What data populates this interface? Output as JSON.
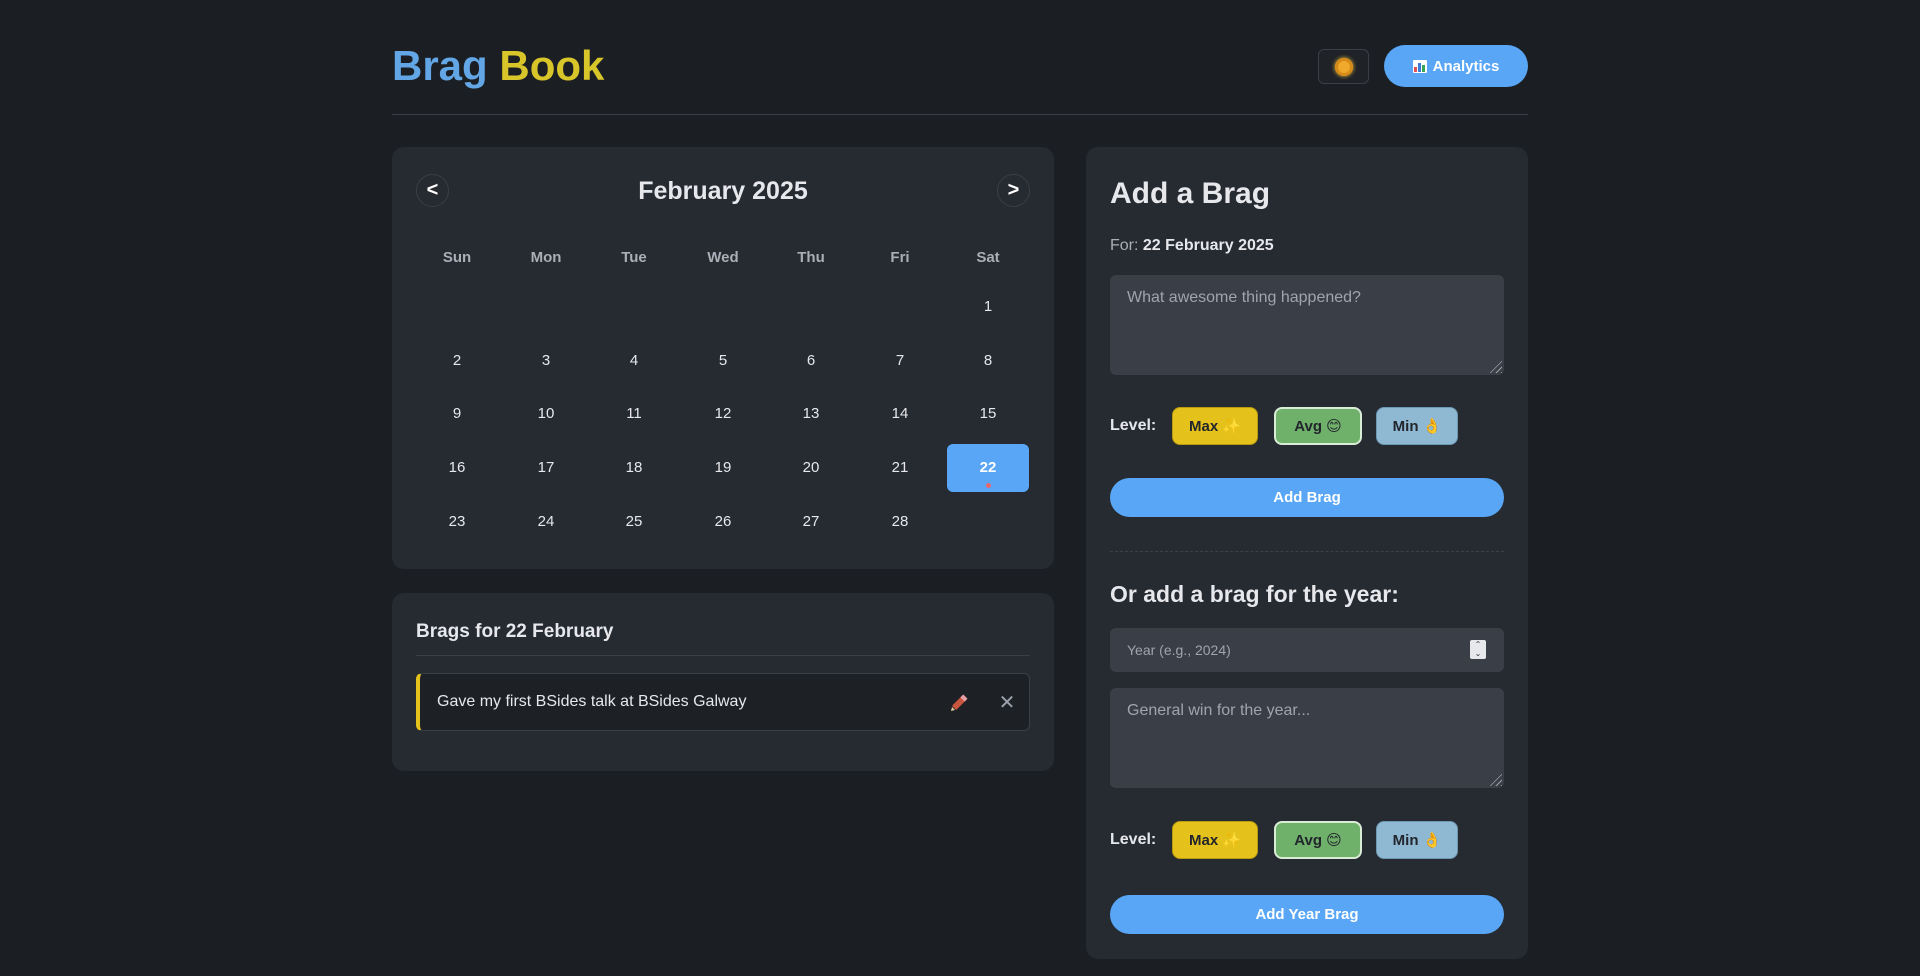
{
  "header": {
    "brand_word1": "Brag",
    "brand_word2": "Book",
    "analytics_label": "Analytics"
  },
  "calendar": {
    "month_label": "February 2025",
    "prev_label": "<",
    "next_label": ">",
    "weekdays": [
      "Sun",
      "Mon",
      "Tue",
      "Wed",
      "Thu",
      "Fri",
      "Sat"
    ],
    "days": {
      "d1": "1",
      "d2": "2",
      "d3": "3",
      "d4": "4",
      "d5": "5",
      "d6": "6",
      "d7": "7",
      "d8": "8",
      "d9": "9",
      "d10": "10",
      "d11": "11",
      "d12": "12",
      "d13": "13",
      "d14": "14",
      "d15": "15",
      "d16": "16",
      "d17": "17",
      "d18": "18",
      "d19": "19",
      "d20": "20",
      "d21": "21",
      "d22": "22",
      "d23": "23",
      "d24": "24",
      "d25": "25",
      "d26": "26",
      "d27": "27",
      "d28": "28"
    },
    "selected_day": "22"
  },
  "brags": {
    "title": "Brags for 22 February",
    "items": [
      {
        "text": "Gave my first BSides talk at BSides Galway",
        "level": "Max"
      }
    ]
  },
  "add_brag": {
    "title": "Add a Brag",
    "for_prefix": "For:",
    "for_date": "22 February 2025",
    "placeholder": "What awesome thing happened?",
    "level_label": "Level:",
    "levels": {
      "max": "Max ✨",
      "avg": "Avg 😊",
      "min": "Min 👌"
    },
    "submit_label": "Add Brag"
  },
  "year_brag": {
    "title": "Or add a brag for the year:",
    "year_placeholder": "Year (e.g., 2024)",
    "placeholder": "General win for the year...",
    "level_label": "Level:",
    "levels": {
      "max": "Max ✨",
      "avg": "Avg 😊",
      "min": "Min 👌"
    },
    "submit_label": "Add Year Brag"
  },
  "colors": {
    "background": "#1b1e23",
    "card": "#262a31",
    "accent": "#58a6f5",
    "max_level": "#e5c21b",
    "avg_level": "#6fb06a",
    "min_level": "#8fb9d3"
  }
}
